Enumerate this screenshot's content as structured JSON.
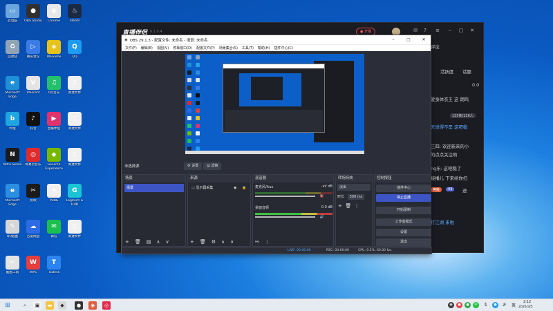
{
  "desktop": {
    "icons": [
      {
        "label": "此电脑",
        "glyph": "▭",
        "color": "#6aa5e0"
      },
      {
        "label": "回收站",
        "glyph": "♻",
        "color": "#8fa4b6"
      },
      {
        "label": "Microsoft Edge",
        "glyph": "e",
        "color": "#1f8fd6"
      },
      {
        "label": "哔哩",
        "glyph": "b",
        "color": "#1fa6e0"
      },
      {
        "label": "Nitro Sense",
        "glyph": "N",
        "color": "#1a1a1a"
      },
      {
        "label": "Microsoft Edge",
        "glyph": "e",
        "color": "#2c8ee0"
      },
      {
        "label": "QQ截图",
        "glyph": "✎",
        "color": "#d7d7d7"
      },
      {
        "label": "截图工具",
        "glyph": "✂",
        "color": "#e4e4e4"
      },
      {
        "label": "OBS Studio",
        "glyph": "●",
        "color": "#303030"
      },
      {
        "label": "腾讯会议",
        "glyph": "▷",
        "color": "#3b7be5"
      },
      {
        "label": "Valorant",
        "glyph": "V",
        "color": "#e4e4e4"
      },
      {
        "label": "抖音",
        "glyph": "♪",
        "color": "#111"
      },
      {
        "label": "网易云音乐",
        "glyph": "◎",
        "color": "#e02b2b"
      },
      {
        "label": "剪映",
        "glyph": "✂",
        "color": "#1b1b1b"
      },
      {
        "label": "百度网盘",
        "glyph": "☁",
        "color": "#2d6be4"
      },
      {
        "label": "WPS",
        "glyph": "W",
        "color": "#e93c3c"
      },
      {
        "label": "Chrome",
        "glyph": "◉",
        "color": "#e8e8e8"
      },
      {
        "label": "WeGame",
        "glyph": "◈",
        "color": "#e8c21c"
      },
      {
        "label": "QQ音乐",
        "glyph": "♫",
        "color": "#23c16b"
      },
      {
        "label": "直播伴侣",
        "glyph": "▶",
        "color": "#e0326d"
      },
      {
        "label": "GeForce Experience",
        "glyph": "◆",
        "color": "#76b900"
      },
      {
        "label": "PUBG",
        "glyph": "✦",
        "color": "#f0f0f0"
      },
      {
        "label": "微信",
        "glyph": "✉",
        "color": "#1bbf4f"
      },
      {
        "label": "ToDesk",
        "glyph": "T",
        "color": "#2b84f0"
      },
      {
        "label": "Steam",
        "glyph": "♨",
        "color": "#1a2a44"
      },
      {
        "label": "QQ",
        "glyph": "Q",
        "color": "#1d9bf0"
      },
      {
        "label": "新建文件",
        "glyph": "▯",
        "color": "#f0f0f0"
      },
      {
        "label": "新建文件",
        "glyph": "▯",
        "color": "#f0f0f0"
      },
      {
        "label": "新建文件",
        "glyph": "▯",
        "color": "#f0f0f0"
      },
      {
        "label": "Logitech G HUB",
        "glyph": "G",
        "color": "#1bc4d4"
      },
      {
        "label": "新建文件",
        "glyph": "▯",
        "color": "#f0f0f0"
      }
    ]
  },
  "zbwindow": {
    "logo": "直播伴侣",
    "version": "6.1.0.4",
    "live_button": "开播",
    "right_panel": {
      "tabs": "评论",
      "tab2": "活跃度",
      "tab3": "话题",
      "counts": "0.0",
      "line1": "爱身体衣王 这 期鸣",
      "badge": "135条/136人",
      "comment1": "天觉得不是 这吧稳",
      "comment2": "三四: 欢迎新来的小",
      "comment3": "的点点关注哟",
      "comment4": "ng乐: 这吧稳了",
      "comment5": "接播儿 下来给你扫",
      "gift_badge": "43",
      "gift_label": "送",
      "comment6": "打江湖 来啦"
    }
  },
  "obs": {
    "title": "OBS 29.1.3 - 配置文件: 未命名 - 场景: 未命名",
    "menu": [
      "文件(F)",
      "编辑(E)",
      "视图(V)",
      "停靠窗口(D)",
      "配置文件(P)",
      "场景集合(S)",
      "工具(T)",
      "帮助(H)",
      "插件中心(C)"
    ],
    "no_source": "未选择源",
    "properties_btn": "设置",
    "filters_btn": "滤镜",
    "docks": {
      "scenes": {
        "title": "场景",
        "items": [
          "场景"
        ]
      },
      "sources": {
        "title": "来源",
        "items": [
          "显示器采集"
        ]
      },
      "mixer": {
        "title": "混音器",
        "channels": [
          {
            "name": "麦克风/Aux",
            "level": "-inf dB"
          },
          {
            "name": "桌面音频",
            "level": "0.0 dB"
          }
        ]
      },
      "transitions": {
        "title": "转场特效",
        "type": "淡出",
        "duration_label": "时长",
        "duration": "300 ms"
      },
      "controls": {
        "title": "控制按钮",
        "buttons": [
          "插件中心",
          "停止直播",
          "开始录制",
          "工作室模式",
          "设置",
          "退出"
        ]
      }
    },
    "status": {
      "live": "LIVE: 00:00:00",
      "rec": "REC: 00:00:00",
      "cpu": "CPU: 0.2%, 60.00 fps"
    }
  },
  "taskbar": {
    "time": "2:12",
    "date": "2026/3/5",
    "lang": "英"
  }
}
